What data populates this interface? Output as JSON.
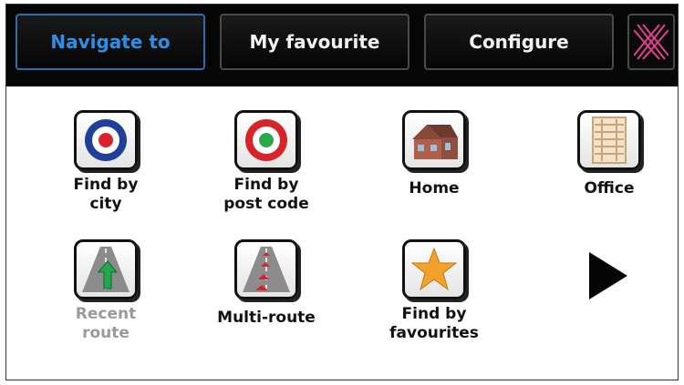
{
  "tabs": [
    {
      "label": "Navigate to",
      "active": true
    },
    {
      "label": "My favourite",
      "active": false
    },
    {
      "label": "Configure",
      "active": false
    }
  ],
  "close_icon": "close-x-icon",
  "colors": {
    "active_tab_text": "#2d8fe8",
    "close_icon": "#e0408f",
    "disabled_label": "#9a9a9a"
  },
  "items": [
    {
      "label": "Find by\ncity",
      "icon": "target-blue-icon"
    },
    {
      "label": "Find by\npost code",
      "icon": "target-green-icon"
    },
    {
      "label": "Home",
      "icon": "house-icon"
    },
    {
      "label": "Office",
      "icon": "office-building-icon"
    },
    {
      "label": "Recent\nroute",
      "icon": "recent-route-icon",
      "disabled": true
    },
    {
      "label": "Multi-route",
      "icon": "multi-route-icon"
    },
    {
      "label": "Find by\nfavourites",
      "icon": "star-icon"
    }
  ],
  "next_icon": "next-page-arrow-icon"
}
